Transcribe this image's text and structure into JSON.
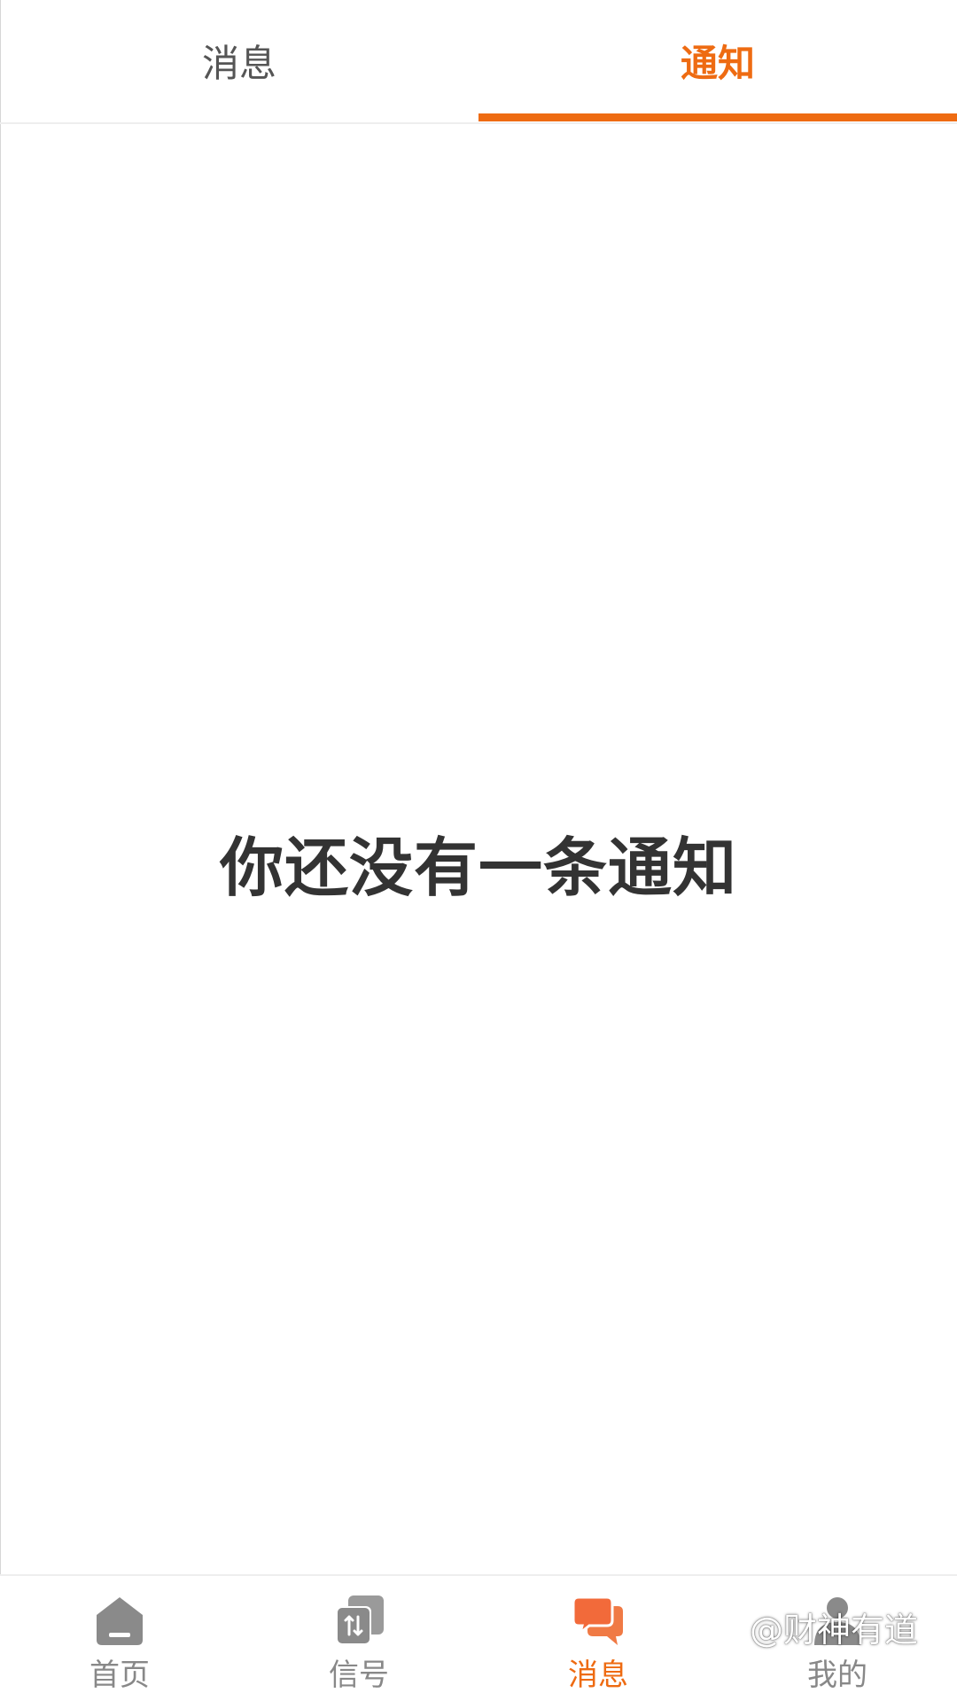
{
  "tabs": {
    "messages_label": "消息",
    "notices_label": "通知",
    "active": "notices"
  },
  "empty_state": {
    "text": "你还没有一条通知"
  },
  "bottom_nav": {
    "items": [
      {
        "label": "首页",
        "icon": "home-icon"
      },
      {
        "label": "信号",
        "icon": "signal-icon"
      },
      {
        "label": "消息",
        "icon": "chat-icon",
        "active": true
      },
      {
        "label": "我的",
        "icon": "user-icon"
      }
    ]
  },
  "watermark": {
    "text": "@财神有道"
  },
  "colors": {
    "accent": "#ee6b12",
    "inactive": "#888888",
    "text_dark": "#333333"
  }
}
